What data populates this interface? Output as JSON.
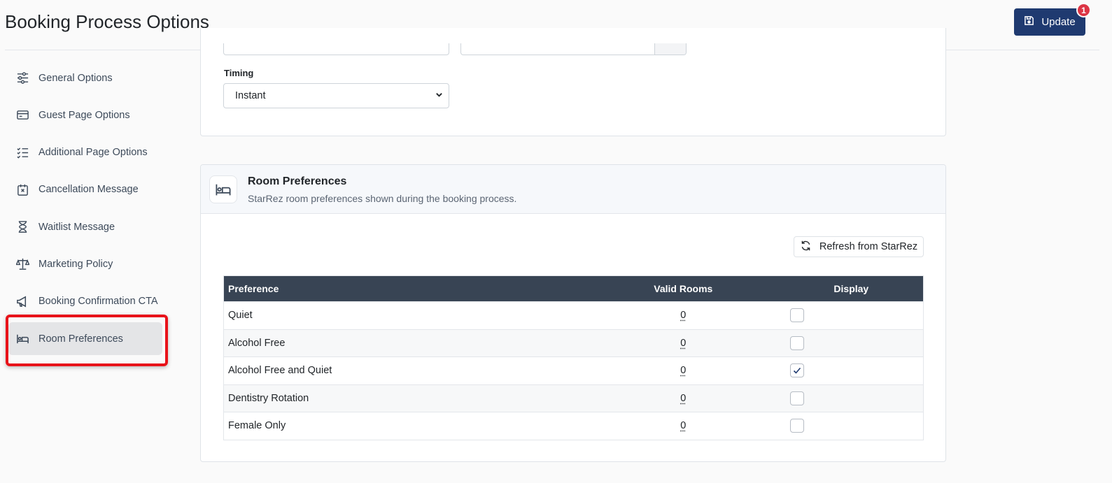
{
  "header": {
    "title": "Booking Process Options",
    "update_label": "Update",
    "update_badge": "1"
  },
  "sidebar": {
    "items": [
      {
        "label": "General Options",
        "icon": "sliders-icon"
      },
      {
        "label": "Guest Page Options",
        "icon": "credit-card-icon"
      },
      {
        "label": "Additional Page Options",
        "icon": "checklist-icon"
      },
      {
        "label": "Cancellation Message",
        "icon": "calendar-x-icon"
      },
      {
        "label": "Waitlist Message",
        "icon": "hourglass-icon"
      },
      {
        "label": "Marketing Policy",
        "icon": "scale-icon"
      },
      {
        "label": "Booking Confirmation CTA",
        "icon": "megaphone-icon"
      },
      {
        "label": "Room Preferences",
        "icon": "bed-icon",
        "active": true
      }
    ]
  },
  "timing": {
    "label": "Timing",
    "value": "Instant"
  },
  "room_preferences": {
    "title": "Room Preferences",
    "subtitle": "StarRez room preferences shown during the booking process.",
    "refresh_label": "Refresh from StarRez",
    "columns": {
      "preference": "Preference",
      "valid_rooms": "Valid Rooms",
      "display": "Display"
    },
    "rows": [
      {
        "preference": "Quiet",
        "valid_rooms": "0",
        "display": false
      },
      {
        "preference": "Alcohol Free",
        "valid_rooms": "0",
        "display": false
      },
      {
        "preference": "Alcohol Free and Quiet",
        "valid_rooms": "0",
        "display": true
      },
      {
        "preference": "Dentistry Rotation",
        "valid_rooms": "0",
        "display": false
      },
      {
        "preference": "Female Only",
        "valid_rooms": "0",
        "display": false
      }
    ]
  },
  "colors": {
    "primary": "#1f3a70",
    "badge": "#dc3545",
    "table_header": "#384454",
    "highlight": "#e8131a"
  }
}
